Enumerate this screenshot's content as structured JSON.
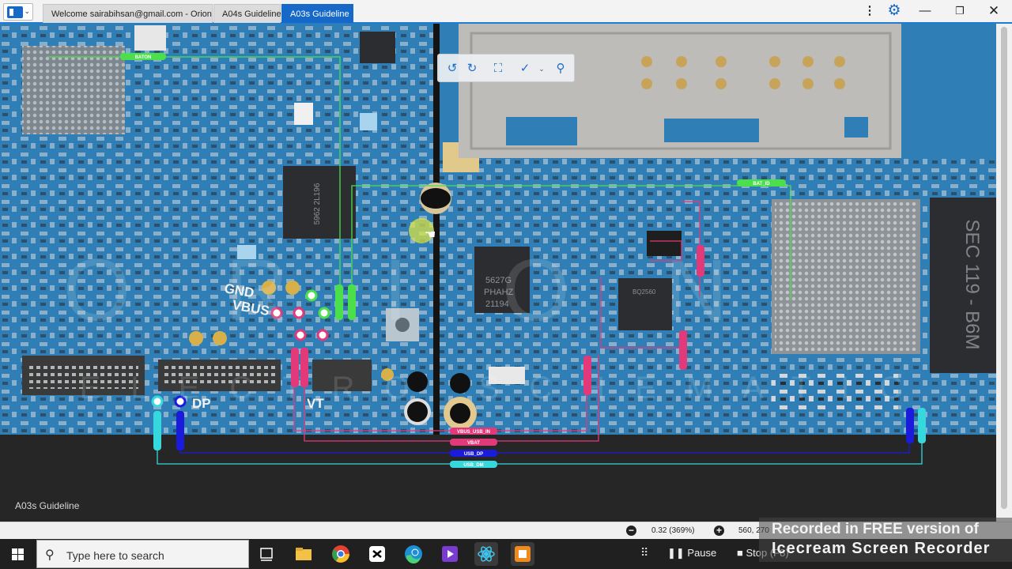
{
  "window": {
    "tabs": [
      {
        "label": "Welcome sairabihsan@gmail.com - Orion",
        "active": false
      },
      {
        "label": "A04s Guideline",
        "active": false
      },
      {
        "label": "A03s Guideline",
        "active": true
      }
    ],
    "kebab_icon": "kebab-menu-icon",
    "gear_icon": "gear-icon",
    "minimize": "—",
    "maximize": "❐",
    "close": "✕"
  },
  "toolbar": {
    "rotate_left": "↺",
    "rotate_right": "↻",
    "fit": "⛶",
    "probe": "✓",
    "search": "⚲"
  },
  "board": {
    "labels": {
      "gnd": "GND",
      "vbus": "VBUS",
      "dp": "DP",
      "vt": "VT",
      "baton": "BATON",
      "bat_id": "BAT_ID",
      "vbus_usb_in": "VBUS_USB_IN",
      "vbat": "VBAT",
      "usb_dp": "USB_DP",
      "usb_dm": "USB_DM",
      "chip_text_1": "5627G",
      "chip_text_2": "PHAHZ",
      "chip_text_3": "21194",
      "chip_small": "BQ2560",
      "watermark_letters": "ORION",
      "schema_text": "ELECTRO SCHEMATIC",
      "right_chip": "SEC 119 - B6M"
    },
    "caption": "A03s Guideline"
  },
  "status": {
    "zoom": "0.32 (369%)",
    "coords": "560, 270",
    "zoom_out": "−",
    "zoom_in": "+"
  },
  "watermark": {
    "line1": "Recorded in FREE version of",
    "line2": "Icecream Screen Recorder"
  },
  "taskbar": {
    "search_placeholder": "Type here to search",
    "pause": "Pause",
    "stop": "Stop (F8)"
  },
  "colors": {
    "board_blue": "#2f7fb6",
    "accent": "#1669c9",
    "net_pink": "#e2397b",
    "net_blue": "#1b1bdc",
    "net_cyan": "#35d8dc",
    "net_green": "#4be04b"
  }
}
